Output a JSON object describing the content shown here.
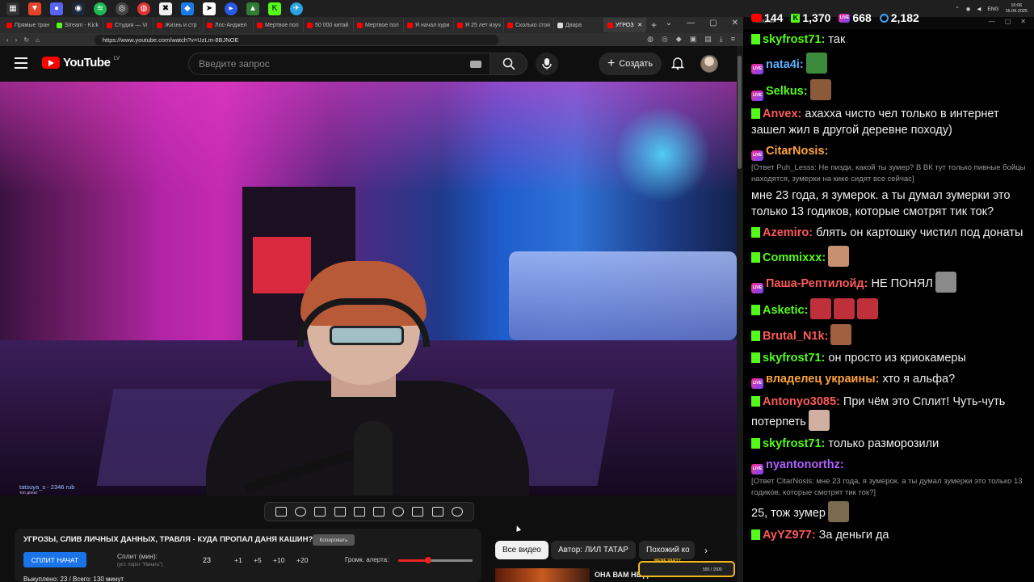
{
  "browser": {
    "tabs": [
      "Прямые тран",
      "Stream - Kick",
      "Студия — Vi",
      "Жизнь и стр",
      "Лос-Анджел",
      "Мертвое пол",
      "50 000 китай",
      "Мертвое пол",
      "Я начал кури",
      "Я 25 лет изуч",
      "Сколько стои",
      "Дварa",
      "УГРОЗ"
    ],
    "url": "https://www.youtube.com/watch?v=UzLm-8BJNOE"
  },
  "youtube": {
    "logo_text": "YouTube",
    "logo_country": "LV",
    "search_placeholder": "Введите запрос",
    "create_label": "Создать"
  },
  "video": {
    "donate_text": "tatsuya_s - 2346 rub",
    "donate_sub": "топ донат"
  },
  "info": {
    "title": "УГРОЗЫ, СЛИВ ЛИЧНЫХ ДАННЫХ, ТРАВЛЯ - КУДА ПРОПАЛ ДАНЯ КАШИН?",
    "copy_label": "Копировать",
    "split_button": "СПЛИТ НАЧАТ",
    "split_label": "Сплит (мин):",
    "split_sub": "(уст. порог \"Начать\")",
    "split_value": "23",
    "steps": [
      "+1",
      "+5",
      "+10",
      "+20"
    ],
    "volume_label": "Громк. алерта:",
    "volume_level": 0.4,
    "bottom_text": "Выкуплено: 23 / Всего: 130 минут"
  },
  "chips": [
    "Все видео",
    "Автор: ЛИЛ ТАТАР",
    "Похожий ко"
  ],
  "recommendation": {
    "title": "ОНА ВАМ НЕ ДАНА - ОЛЬКЫ",
    "meme_badge": "MEME PARTY",
    "meme_value": "555 / 1500"
  },
  "system": {
    "lang": "ENG",
    "time": "16:06",
    "date": "16.09.2025"
  },
  "chat_window": {
    "title": "AxelChat"
  },
  "stats": {
    "youtube": "144",
    "kick": "1,370",
    "live": "668",
    "viewers": "2,182"
  },
  "colors": {
    "kick": "#53fc18",
    "youtube": "#ff0000",
    "accent_blue": "#1a73e8"
  },
  "chat": [
    {
      "platform": "kick",
      "user": "skyfrost71:",
      "color": "#53fc18",
      "text": "так"
    },
    {
      "platform": "live",
      "user": "nata4i:",
      "color": "#5ab0ff",
      "text": "",
      "emote": "#3c8a3c"
    },
    {
      "platform": "live",
      "user": "Selkus:",
      "color": "#53fc18",
      "text": "",
      "emote": "#8a5a3a"
    },
    {
      "platform": "kick",
      "user": "Anvex:",
      "color": "#ff5a5a",
      "text": "ахахха чисто чел только в интернет зашел жил в другой деревне походу)"
    },
    {
      "platform": "live",
      "user": "CitarNosis:",
      "color": "#ffa43a",
      "reply": "[Ответ Puh_Lesss: Не пизди, какой ты зумер? В ВК тут только пивные бойцы находятся, зумерки на кике сидят все сейчас]",
      "text": "мне 23 года, я зумерок. а ты думал зумерки это только 13 годиков, которые смотрят тик ток?"
    },
    {
      "platform": "kick",
      "user": "Azemiro:",
      "color": "#ff5a5a",
      "text": "блять он картошку чистил под донаты"
    },
    {
      "platform": "kick",
      "user": "Commixxx:",
      "color": "#53fc18",
      "text": "",
      "emote": "#c89070"
    },
    {
      "platform": "live",
      "user": "Паша-Рептилойд:",
      "color": "#ff5a5a",
      "text": "НЕ ПОНЯЛ",
      "emote": "#8a8a8a"
    },
    {
      "platform": "kick",
      "user": "Asketic:",
      "color": "#53fc18",
      "text": "",
      "emote": "#c0303a",
      "emote_count": 3
    },
    {
      "platform": "kick",
      "user": "Brutal_N1k:",
      "color": "#ff5a5a",
      "text": "",
      "emote": "#a06040"
    },
    {
      "platform": "kick",
      "user": "skyfrost71:",
      "color": "#53fc18",
      "text": "он просто из криокамеры"
    },
    {
      "platform": "live",
      "user": "владелец украины:",
      "color": "#ffa43a",
      "text": "хто я альфа?"
    },
    {
      "platform": "kick",
      "user": "Antonyo3085:",
      "color": "#ff5a5a",
      "text": "При чём это Сплит! Чуть-чуть потерпеть",
      "emote": "#d0b0a0"
    },
    {
      "platform": "kick",
      "user": "skyfrost71:",
      "color": "#53fc18",
      "text": "только разморозили"
    },
    {
      "platform": "live",
      "user": "nyantonorthz:",
      "color": "#b060ff",
      "reply": "[Ответ CitarNosis: мне 23 года, я зумерок. а ты думал зумерки это только 13 годиков, которые смотрят тик ток?]",
      "text": "25, тож зумер",
      "emote": "#7a6a50"
    },
    {
      "platform": "kick",
      "user": "AyYZ977:",
      "color": "#ff5a5a",
      "text": "За деньги да"
    }
  ]
}
